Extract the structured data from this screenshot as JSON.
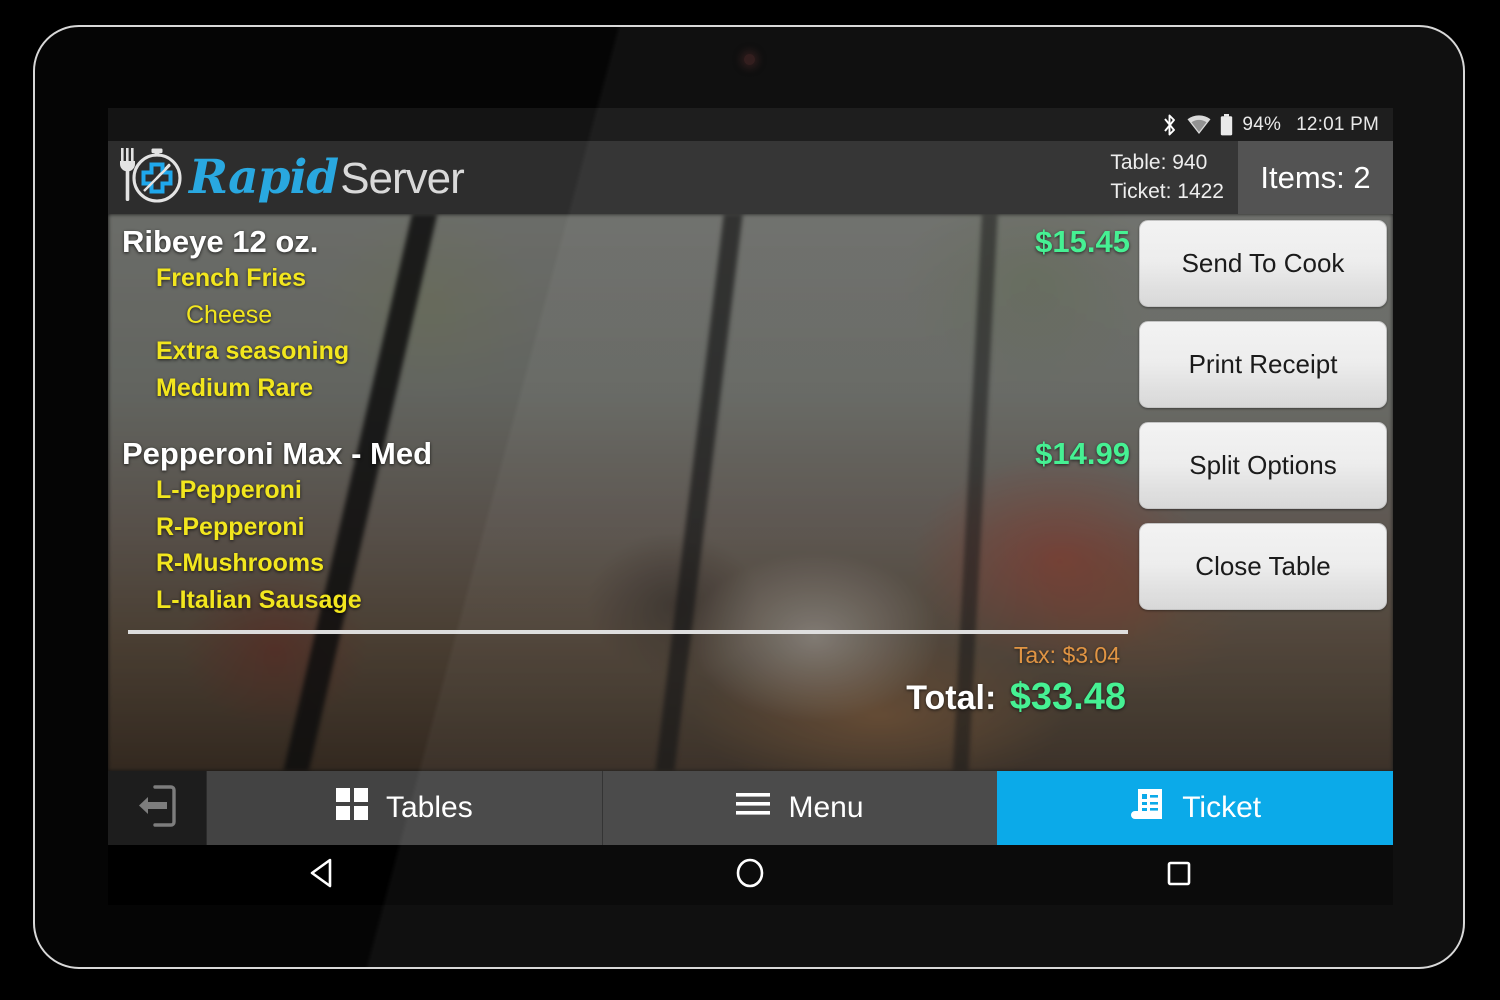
{
  "status_bar": {
    "bluetooth_icon": "bluetooth-icon",
    "wifi_icon": "wifi-icon",
    "battery_icon": "battery-icon",
    "battery_percent": "94%",
    "time": "12:01 PM"
  },
  "header": {
    "logo_icon": "stopwatch-fork-logo-icon",
    "brand_first": "Rapid",
    "brand_second": "Server",
    "table_label": "Table: 940",
    "ticket_label": "Ticket: 1422",
    "items_label": "Items:  2"
  },
  "ticket": {
    "items": [
      {
        "name": "Ribeye 12 oz.",
        "price": "$15.45",
        "modifiers": [
          {
            "label": "French Fries",
            "sub": false
          },
          {
            "label": "Cheese",
            "sub": true
          },
          {
            "label": "Extra seasoning",
            "sub": false
          },
          {
            "label": "Medium Rare",
            "sub": false
          }
        ]
      },
      {
        "name": "Pepperoni Max - Med",
        "price": "$14.99",
        "modifiers": [
          {
            "label": "L-Pepperoni",
            "sub": false
          },
          {
            "label": "R-Pepperoni",
            "sub": false
          },
          {
            "label": "R-Mushrooms",
            "sub": false
          },
          {
            "label": "L-Italian Sausage",
            "sub": false
          }
        ]
      }
    ],
    "tax_label": "Tax:",
    "tax_value": "$3.04",
    "total_label": "Total:",
    "total_value": "$33.48"
  },
  "actions": [
    {
      "label": "Send To Cook"
    },
    {
      "label": "Print Receipt"
    },
    {
      "label": "Split Options"
    },
    {
      "label": "Close Table"
    }
  ],
  "tabbar": {
    "logout_icon": "logout-icon",
    "tabs": [
      {
        "label": "Tables",
        "icon": "grid-icon",
        "active": false
      },
      {
        "label": "Menu",
        "icon": "hamburger-icon",
        "active": false
      },
      {
        "label": "Ticket",
        "icon": "receipt-icon",
        "active": true
      }
    ]
  },
  "navbar": {
    "back_icon": "back-triangle-icon",
    "home_icon": "home-circle-icon",
    "recents_icon": "recents-square-icon"
  },
  "colors": {
    "accent_blue": "#00a6e8",
    "brand_blue": "#29a8e0",
    "price_green": "#3ef08e",
    "modifier_yellow": "#f2e61e",
    "tax_orange": "#e0903b",
    "header_gray": "#2d2d2d",
    "tab_gray": "#434343"
  }
}
